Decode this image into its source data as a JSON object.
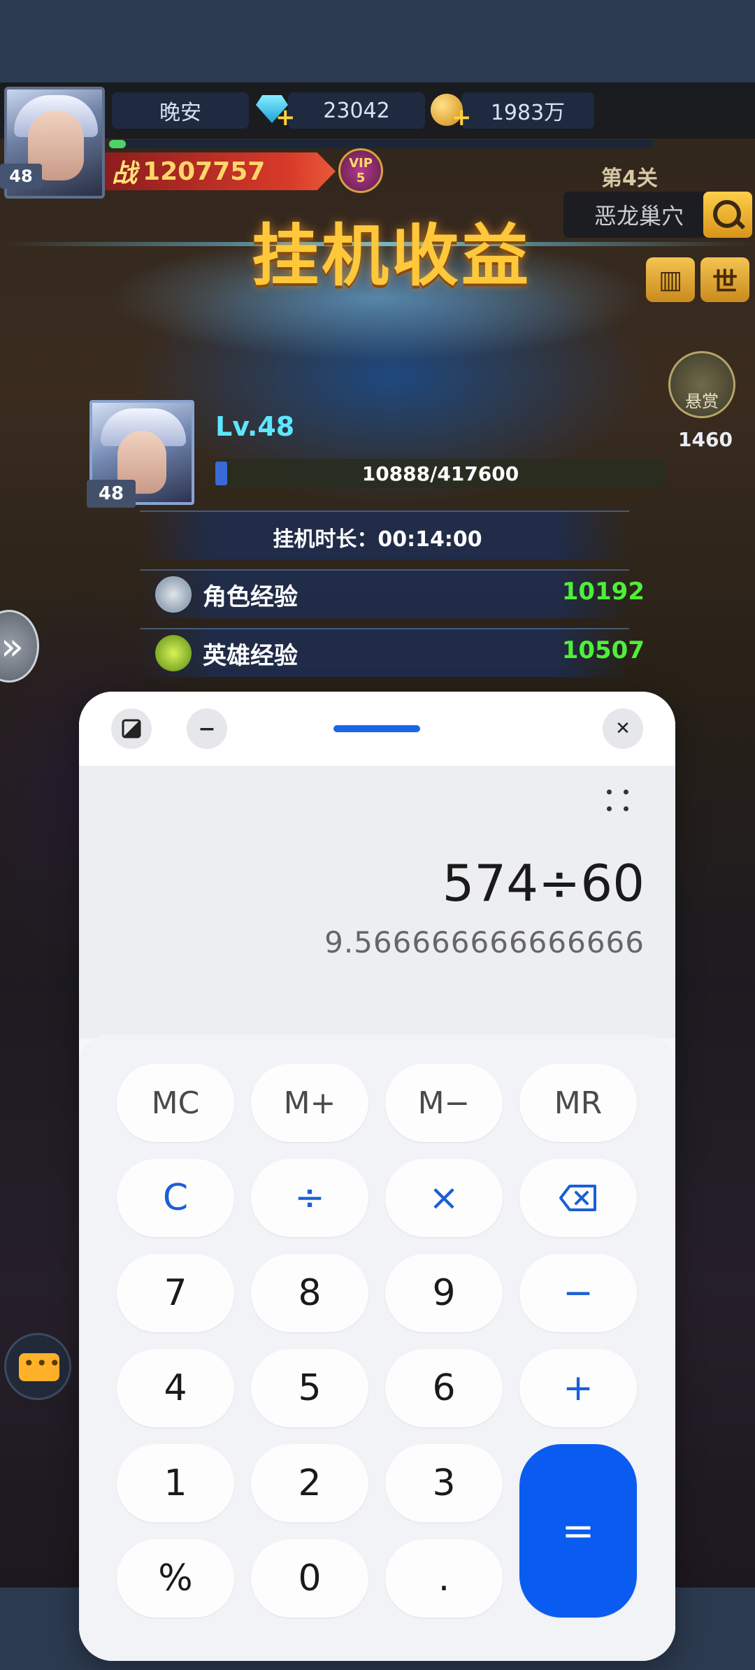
{
  "game": {
    "player_name": "晚安",
    "player_level": "48",
    "diamonds": "23042",
    "gold": "1983万",
    "power_prefix": "战",
    "power": "1207757",
    "vip_label": "VIP",
    "vip_level": "5",
    "stage": "第4关",
    "location": "恶龙巢穴",
    "side_btn_book": "▥",
    "side_btn_world": "世",
    "bounty_label": "悬赏",
    "bounty_value": "1460",
    "banner_title": "挂机收益",
    "hero_level_text": "Lv.48",
    "hero_level_badge": "48",
    "exp_progress": "10888/417600",
    "exp_fraction": 0.026,
    "idle_duration": "挂机时长：00:14:00",
    "rewards": [
      {
        "label": "角色经验",
        "value": "10192",
        "icon": "exp-icon"
      },
      {
        "label": "英雄经验",
        "value": "10507",
        "icon": "hero-exp-icon"
      }
    ]
  },
  "calculator": {
    "expression": "574÷60",
    "result": "9.566666666666666",
    "titlebar": {
      "minimize": "−",
      "close": "✕"
    },
    "keys": {
      "mc": "MC",
      "mplus": "M+",
      "mminus": "M−",
      "mr": "MR",
      "clear": "C",
      "divide": "÷",
      "multiply": "×",
      "backspace": "⌫",
      "seven": "7",
      "eight": "8",
      "nine": "9",
      "minus": "−",
      "four": "4",
      "five": "5",
      "six": "6",
      "plus": "+",
      "one": "1",
      "two": "2",
      "three": "3",
      "equals": "=",
      "percent": "%",
      "zero": "0",
      "dot": "."
    },
    "accent_color": "#0a5cf0"
  }
}
